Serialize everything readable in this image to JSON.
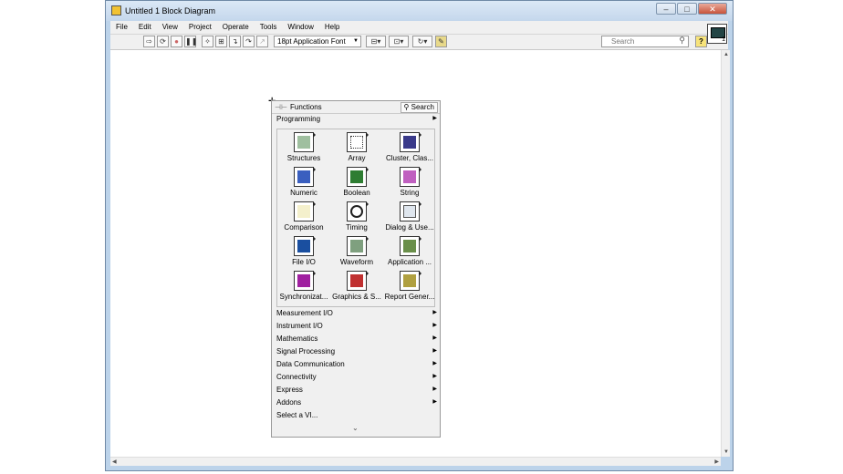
{
  "window": {
    "title": "Untitled 1 Block Diagram",
    "controls": [
      "–",
      "□",
      "✕"
    ]
  },
  "menu": [
    "File",
    "Edit",
    "View",
    "Project",
    "Operate",
    "Tools",
    "Window",
    "Help"
  ],
  "toolbar": {
    "font": "18pt Application Font",
    "search_placeholder": "Search",
    "help": "?"
  },
  "vi_icon": {
    "number": "1"
  },
  "palette": {
    "title": "Functions",
    "search_label": "Search",
    "current_category": "Programming",
    "icons": [
      {
        "label": "Structures",
        "icon": "structures-icon",
        "color": "#9fbf9f"
      },
      {
        "label": "Array",
        "icon": "array-icon",
        "color": "#ffffff"
      },
      {
        "label": "Cluster, Clas...",
        "icon": "cluster-icon",
        "color": "#3a3a8a"
      },
      {
        "label": "Numeric",
        "icon": "numeric-icon",
        "color": "#3a5fbf"
      },
      {
        "label": "Boolean",
        "icon": "boolean-icon",
        "color": "#2e7d32"
      },
      {
        "label": "String",
        "icon": "string-icon",
        "color": "#c060c0"
      },
      {
        "label": "Comparison",
        "icon": "comparison-icon",
        "color": "#f4f0cc"
      },
      {
        "label": "Timing",
        "icon": "timing-icon",
        "color": "#222222"
      },
      {
        "label": "Dialog & Use...",
        "icon": "dialog-icon",
        "color": "#dfe6ee"
      },
      {
        "label": "File I/O",
        "icon": "file-io-icon",
        "color": "#1a4fa0"
      },
      {
        "label": "Waveform",
        "icon": "waveform-icon",
        "color": "#7fa07f"
      },
      {
        "label": "Application ...",
        "icon": "application-control-icon",
        "color": "#6a8f4a"
      },
      {
        "label": "Synchronizat...",
        "icon": "synchronization-icon",
        "color": "#a020a0"
      },
      {
        "label": "Graphics & S...",
        "icon": "graphics-sound-icon",
        "color": "#c03030"
      },
      {
        "label": "Report Gener...",
        "icon": "report-generation-icon",
        "color": "#b0a040"
      }
    ],
    "categories": [
      "Measurement I/O",
      "Instrument I/O",
      "Mathematics",
      "Signal Processing",
      "Data Communication",
      "Connectivity",
      "Express",
      "Addons"
    ],
    "select_vi": "Select a VI...",
    "expand": "⌄"
  }
}
